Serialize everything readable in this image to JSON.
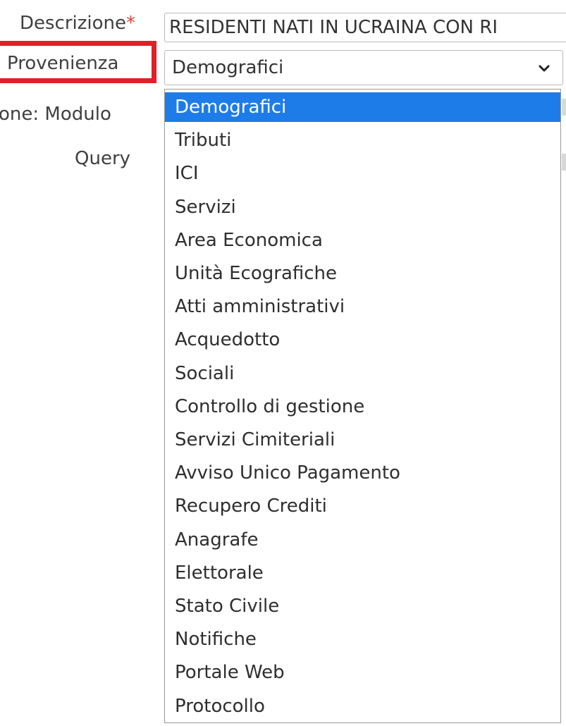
{
  "form": {
    "descrizione_label": "Descrizione",
    "required_mark": "*",
    "descrizione_value": "RESIDENTI NATI IN UCRAINA CON RI",
    "provenienza_label": "Provenienza",
    "provenienza_selected": "Demografici",
    "modulo_label": "one: Modulo",
    "query_label": "Query"
  },
  "dropdown": {
    "selected_index": 0,
    "options": [
      "Demografici",
      "Tributi",
      "ICI",
      "Servizi",
      "Area Economica",
      "Unità Ecografiche",
      "Atti amministrativi",
      "Acquedotto",
      "Sociali",
      "Controllo di gestione",
      "Servizi Cimiteriali",
      "Avviso Unico Pagamento",
      "Recupero Crediti",
      "Anagrafe",
      "Elettorale",
      "Stato Civile",
      "Notifiche",
      "Portale Web",
      "Protocollo"
    ]
  },
  "colors": {
    "highlight_border": "#e01f26",
    "selected_option_bg": "#1e7ce8",
    "required_mark": "#e0413f"
  },
  "icons": {
    "select_arrow": "chevron-down-icon"
  }
}
